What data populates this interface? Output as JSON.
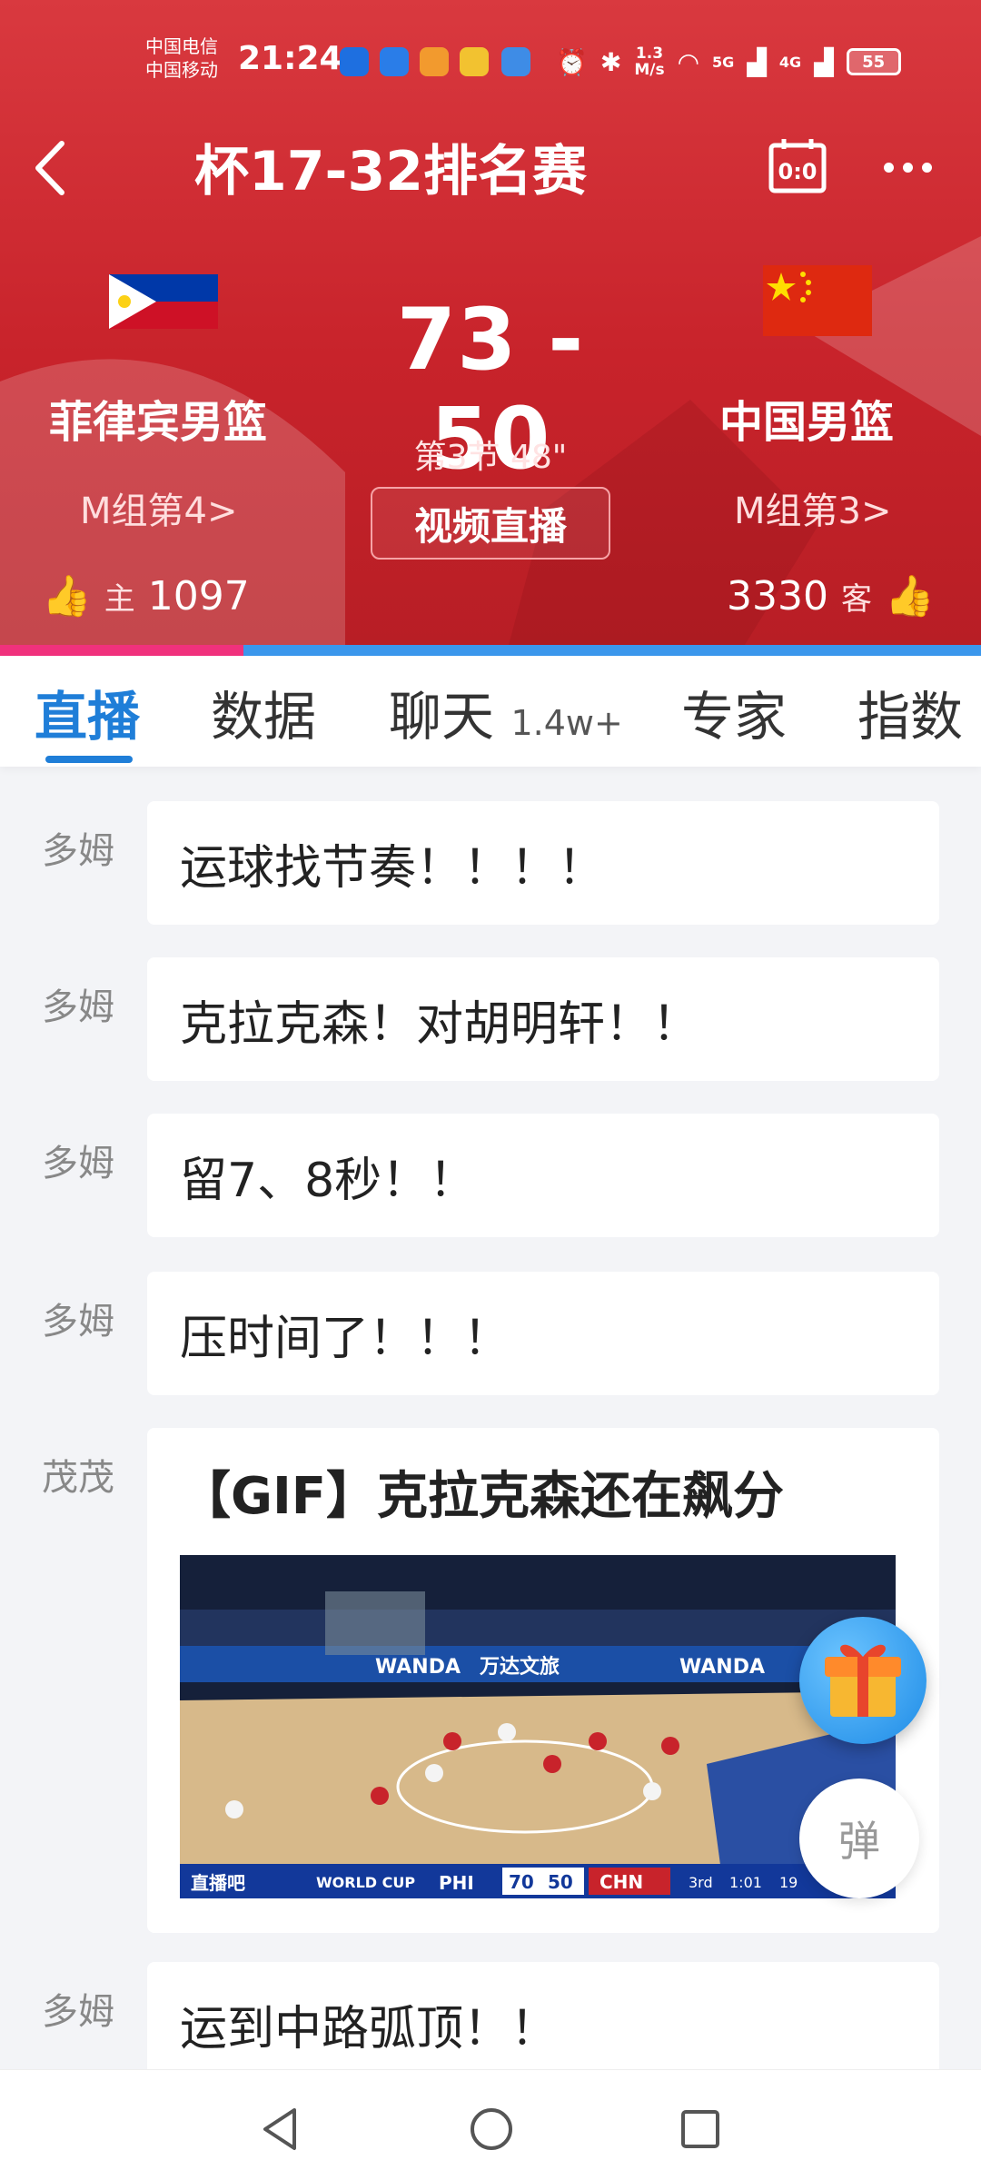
{
  "status_bar": {
    "carrier_1": "中国电信",
    "carrier_2": "中国移动",
    "time": "21:24",
    "net_speed_value": "1.3",
    "net_speed_unit": "M/s",
    "sim1_label": "5G",
    "sim2_label": "4G",
    "battery": "55"
  },
  "header": {
    "title": "杯17-32排名赛",
    "score_icon": "scoreboard-icon",
    "more_icon": "more-icon"
  },
  "match": {
    "home": {
      "name": "菲律宾男篮",
      "group": "M组第4>",
      "likes_label": "主",
      "likes": "1097",
      "flag": "philippines-flag"
    },
    "away": {
      "name": "中国男篮",
      "group": "M组第3>",
      "likes_label": "客",
      "likes": "3330",
      "flag": "china-flag"
    },
    "score": "73 - 50",
    "period": "第3节 48\"",
    "live_button": "视频直播"
  },
  "tabs": [
    {
      "label": "直播",
      "active": true
    },
    {
      "label": "数据"
    },
    {
      "label": "聊天",
      "badge": "1.4w+"
    },
    {
      "label": "专家"
    },
    {
      "label": "指数"
    }
  ],
  "feed": [
    {
      "author": "多姆",
      "text": "运球找节奏！！！！"
    },
    {
      "author": "多姆",
      "text": "克拉克森！对胡明轩！！"
    },
    {
      "author": "多姆",
      "text": "留7、8秒！！"
    },
    {
      "author": "多姆",
      "text": "压时间了！！！"
    },
    {
      "author": "茂茂",
      "title": "【GIF】克拉克森还在飙分",
      "scorebug": {
        "brand": "直播吧",
        "event": "WORLD CUP",
        "home": "PHI",
        "home_score": "70",
        "away_score": "50",
        "away": "CHN",
        "quarter": "3rd",
        "clock": "1:01",
        "shot_clock": "19"
      },
      "banners": [
        "WANDA",
        "万达文旅",
        "WANDA"
      ]
    },
    {
      "author": "多姆",
      "text": "运到中路弧顶！！"
    }
  ],
  "floating": {
    "gift_icon": "gift-icon",
    "danmu_label": "弹"
  },
  "colors": {
    "header_red": "#c8232b",
    "accent_blue": "#1f7ed8",
    "home_bar": "#f0317c",
    "away_bar": "#3b97ec"
  }
}
